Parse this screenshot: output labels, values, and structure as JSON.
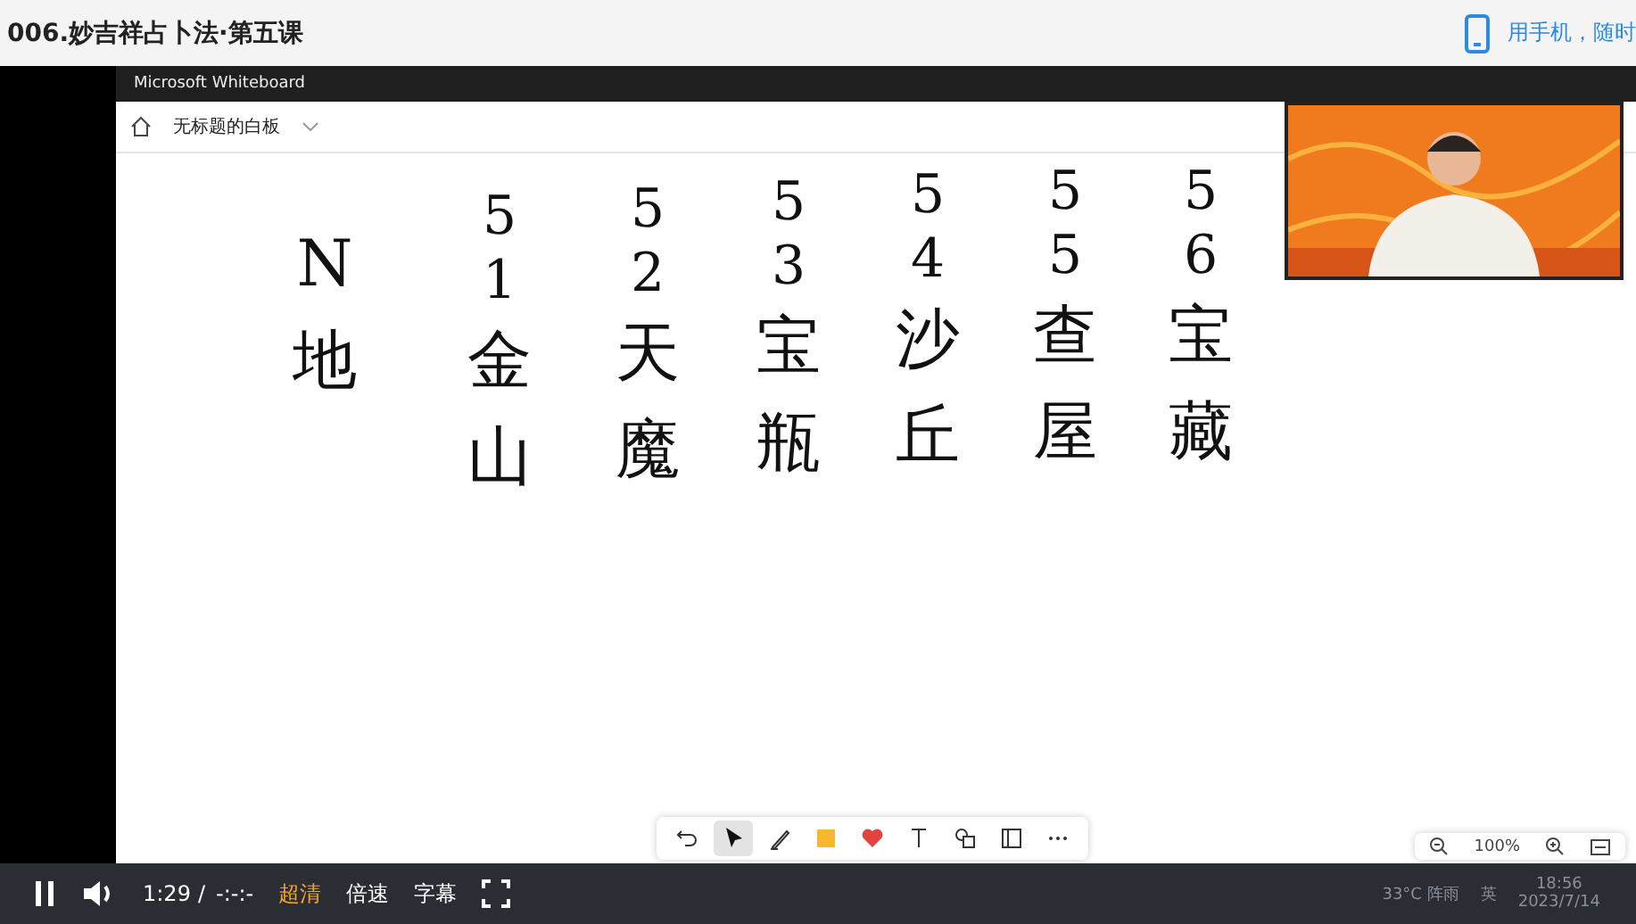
{
  "page_title": "006.妙吉祥占卜法·第五课",
  "mobile_link": "用手机，随时",
  "recording": {
    "app_title": "Microsoft Whiteboard",
    "board_name": "无标题的白板",
    "columns": [
      {
        "lines": [
          "N",
          "地"
        ]
      },
      {
        "lines": [
          "5",
          "1",
          "金",
          "山"
        ]
      },
      {
        "lines": [
          "5",
          "2",
          "天",
          "魔"
        ]
      },
      {
        "lines": [
          "5",
          "3",
          "宝",
          "瓶"
        ]
      },
      {
        "lines": [
          "5",
          "4",
          "沙",
          "丘"
        ]
      },
      {
        "lines": [
          "5",
          "5",
          "查",
          "屋"
        ]
      },
      {
        "lines": [
          "5",
          "6",
          "宝",
          "藏"
        ]
      }
    ],
    "tools": [
      {
        "kind": "undo",
        "selected": false
      },
      {
        "kind": "select",
        "selected": true
      },
      {
        "kind": "pen",
        "selected": false
      },
      {
        "kind": "note",
        "selected": false
      },
      {
        "kind": "heart",
        "selected": false
      },
      {
        "kind": "text",
        "selected": false
      },
      {
        "kind": "shapes",
        "selected": false
      },
      {
        "kind": "template",
        "selected": false
      },
      {
        "kind": "more",
        "selected": false
      }
    ],
    "zoom": "100%",
    "taskbar": {
      "weather": "33°C 阵雨",
      "ime": "英",
      "time": "18:56",
      "date": "2023/7/14"
    }
  },
  "player": {
    "playing": true,
    "time": "1:29",
    "separator": "/",
    "duration": "-:-:-",
    "quality": "超清",
    "speed": "倍速",
    "subtitles": "字幕"
  }
}
